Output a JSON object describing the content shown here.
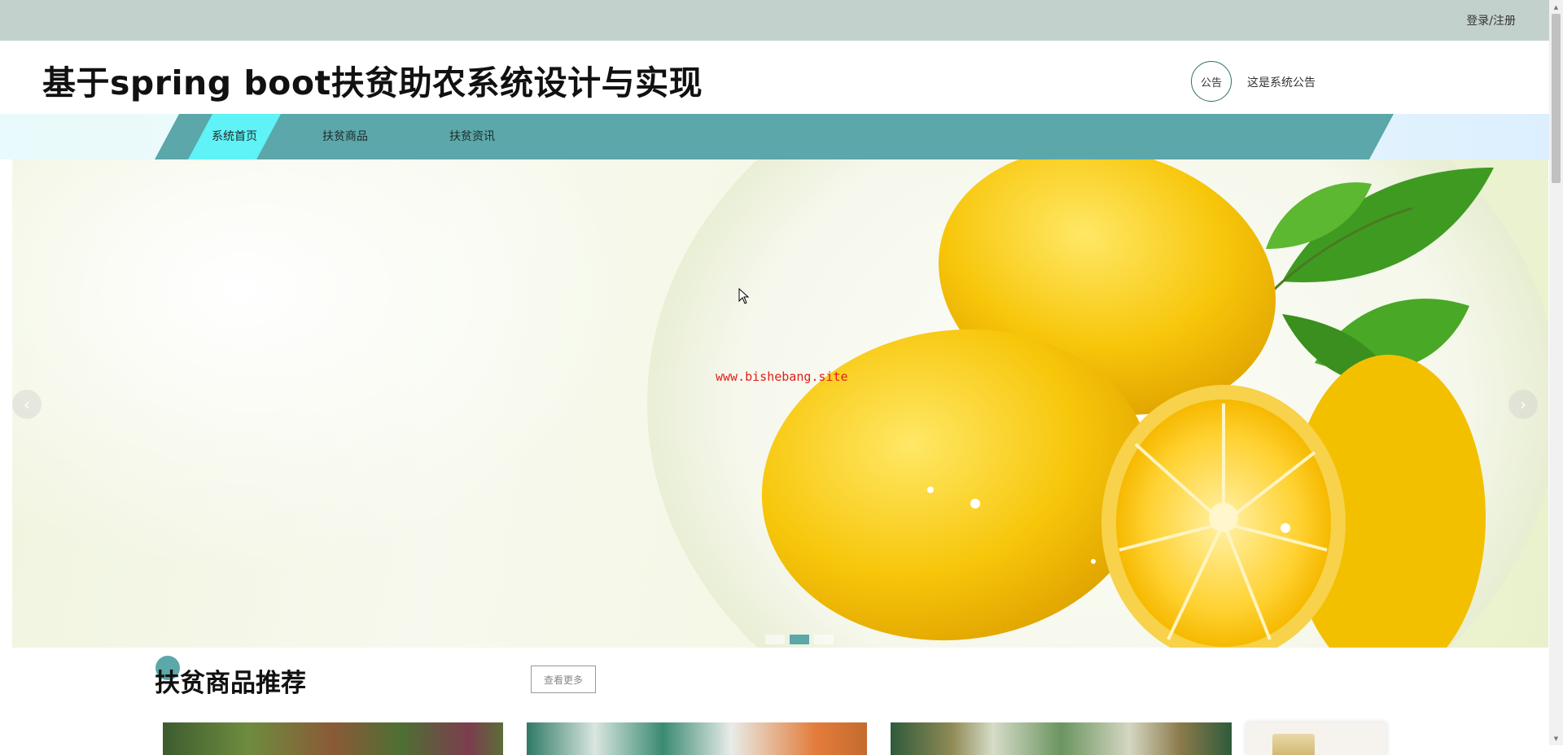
{
  "topbar": {
    "login_label": "登录/注册"
  },
  "header": {
    "title": "基于spring boot扶贫助农系统设计与实现",
    "notice_badge": "公告",
    "notice_text": "这是系统公告"
  },
  "nav": {
    "items": [
      {
        "label": "系统首页",
        "active": true
      },
      {
        "label": "扶贫商品",
        "active": false
      },
      {
        "label": "扶贫资讯",
        "active": false
      }
    ]
  },
  "banner": {
    "watermark": "www.bishebang.site",
    "slide_count": 3,
    "active_slide": 2,
    "prev_icon": "chevron-left-icon",
    "next_icon": "chevron-right-icon"
  },
  "section": {
    "title": "扶贫商品推荐",
    "more_label": "查看更多"
  },
  "colors": {
    "accent": "#5ba7a9",
    "nav_active": "#5ff2f6",
    "topbar": "#c3d1cd",
    "watermark": "#e0201a"
  }
}
